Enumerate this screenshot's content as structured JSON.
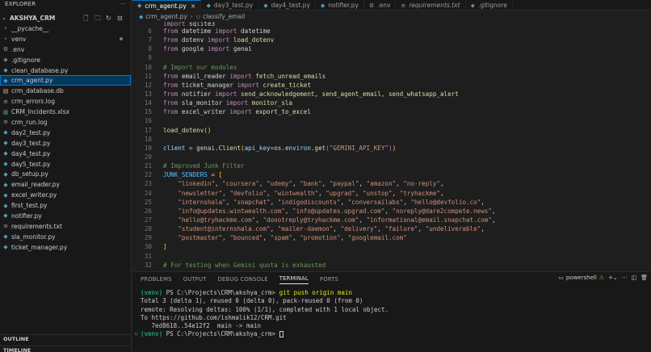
{
  "sidebar": {
    "header": "EXPLORER",
    "more": "···",
    "project": "AKSHYA_CRM",
    "items": [
      {
        "label": "__pycache__",
        "kind": "folder"
      },
      {
        "label": "venv",
        "kind": "folder"
      },
      {
        "label": ".env",
        "kind": "gear"
      },
      {
        "label": ".gitignore",
        "kind": "gear"
      },
      {
        "label": "clean_database.py",
        "kind": "py"
      },
      {
        "label": "crm_agent.py",
        "kind": "py"
      },
      {
        "label": "crm_database.db",
        "kind": "db"
      },
      {
        "label": "crm_errors.log",
        "kind": "log"
      },
      {
        "label": "CRM_Incidents.xlsx",
        "kind": "xlsx"
      },
      {
        "label": "crm_run.log",
        "kind": "log"
      },
      {
        "label": "day2_test.py",
        "kind": "py"
      },
      {
        "label": "day3_test.py",
        "kind": "py"
      },
      {
        "label": "day4_test.py",
        "kind": "py"
      },
      {
        "label": "day5_test.py",
        "kind": "py"
      },
      {
        "label": "db_setup.py",
        "kind": "py"
      },
      {
        "label": "email_reader.py",
        "kind": "py"
      },
      {
        "label": "excel_writer.py",
        "kind": "py"
      },
      {
        "label": "first_test.py",
        "kind": "py"
      },
      {
        "label": "notifier.py",
        "kind": "py"
      },
      {
        "label": "requirements.txt",
        "kind": "txt"
      },
      {
        "label": "sla_monitor.py",
        "kind": "py"
      },
      {
        "label": "ticket_manager.py",
        "kind": "py"
      }
    ],
    "outline": "OUTLINE",
    "timeline": "TIMELINE"
  },
  "tabs": [
    {
      "label": "crm_agent.py",
      "icon": "py",
      "active": true
    },
    {
      "label": "day3_test.py",
      "icon": "py"
    },
    {
      "label": "day4_test.py",
      "icon": "py"
    },
    {
      "label": "notifier.py",
      "icon": "py"
    },
    {
      "label": ".env",
      "icon": "gear"
    },
    {
      "label": "requirements.txt",
      "icon": "txt",
      "italic": true
    },
    {
      "label": ".gitignore",
      "icon": "gear"
    }
  ],
  "breadcrumb": {
    "file": "crm_agent.py",
    "symbol": "classify_email"
  },
  "editor": {
    "lines": [
      {
        "n": "",
        "t": "import sqlite3",
        "cls": "partial"
      },
      {
        "n": "6"
      },
      {
        "n": "7"
      },
      {
        "n": "8"
      },
      {
        "n": "9"
      },
      {
        "n": "10"
      },
      {
        "n": "11"
      },
      {
        "n": "12"
      },
      {
        "n": "13"
      },
      {
        "n": "14"
      },
      {
        "n": "15"
      },
      {
        "n": "16"
      },
      {
        "n": "17"
      },
      {
        "n": "18"
      },
      {
        "n": "19"
      },
      {
        "n": "20"
      },
      {
        "n": "21"
      },
      {
        "n": "22"
      },
      {
        "n": "23"
      },
      {
        "n": "24"
      },
      {
        "n": "25"
      },
      {
        "n": "26"
      },
      {
        "n": "27"
      },
      {
        "n": "28"
      },
      {
        "n": "29"
      },
      {
        "n": "30"
      },
      {
        "n": "31"
      },
      {
        "n": "32"
      }
    ]
  },
  "panel": {
    "tabs": [
      "PROBLEMS",
      "OUTPUT",
      "DEBUG CONSOLE",
      "TERMINAL",
      "PORTS"
    ],
    "shell": "powershell",
    "terminal": [
      {
        "venv": "(venv)",
        "rest": " PS C:\\Projects\\CRM\\akshya_crm> ",
        "cmd": "git push origin main"
      },
      {
        "text": "Total 3 (delta 1), reused 0 (delta 0), pack-reused 0 (from 0)"
      },
      {
        "text": "remote: Resolving deltas: 100% (1/1), completed with 1 local object."
      },
      {
        "text": "To https://github.com/ishmalik12/CRM.git"
      },
      {
        "text": "   7ed8618..54e12f2  main -> main"
      },
      {
        "venv": "(venv)",
        "rest": " PS C:\\Projects\\CRM\\akshya_crm> ",
        "cmd": ""
      }
    ]
  },
  "colors": {
    "accent": "#0078d4",
    "editor_bg": "#1e1e1e",
    "sidebar_bg": "#181818"
  }
}
